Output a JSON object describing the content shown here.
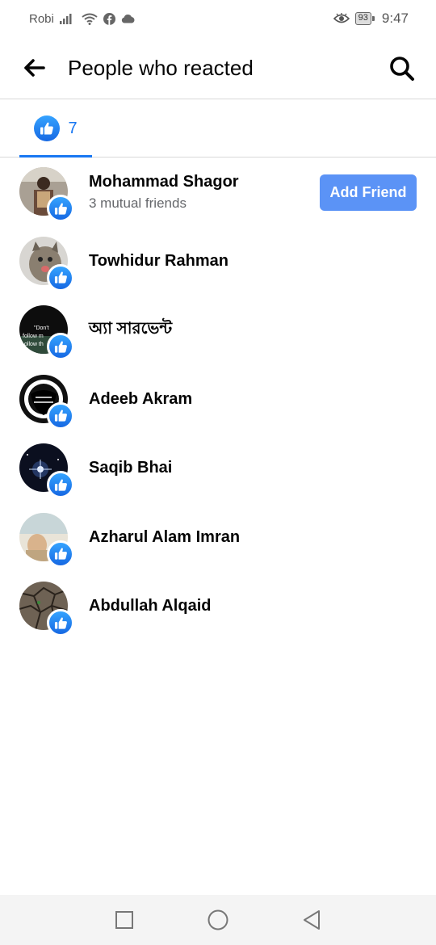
{
  "status_bar": {
    "carrier": "Robi",
    "battery": "93",
    "time": "9:47"
  },
  "header": {
    "title": "People who reacted"
  },
  "tabs": [
    {
      "count": "7",
      "icon": "like-icon"
    }
  ],
  "people": [
    {
      "name": "Mohammad Shagor",
      "mutual": "3 mutual friends",
      "action": "Add Friend"
    },
    {
      "name": "Towhidur Rahman"
    },
    {
      "name": "অ্যা সারভেন্ট"
    },
    {
      "name": "Adeeb Akram"
    },
    {
      "name": "Saqib Bhai"
    },
    {
      "name": "Azharul Alam Imran"
    },
    {
      "name": "Abdullah Alqaid"
    }
  ],
  "avatar_texts": {
    "quote_line1": "\"Don't",
    "quote_line2": "follow m",
    "quote_line3": "ollow th"
  },
  "colors": {
    "accent": "#1877f2",
    "add_friend_bg": "#5b93f6",
    "secondary_text": "#65676b"
  }
}
